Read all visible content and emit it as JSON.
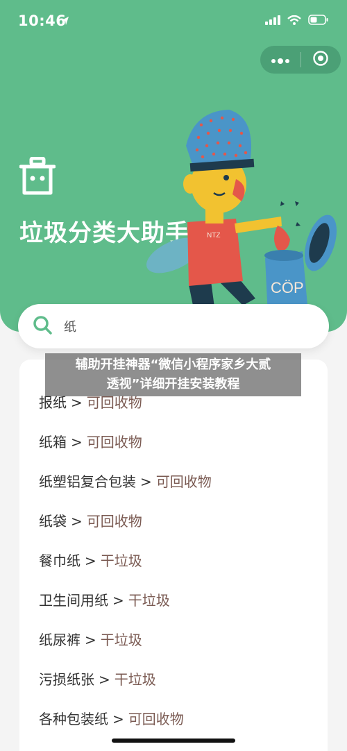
{
  "status_bar": {
    "time": "10:46"
  },
  "header": {
    "title": "垃圾分类大助手"
  },
  "search": {
    "value": "纸"
  },
  "results": [
    {
      "item": "报纸",
      "category": "可回收物"
    },
    {
      "item": "纸箱",
      "category": "可回收物"
    },
    {
      "item": "纸塑铝复合包装",
      "category": "可回收物"
    },
    {
      "item": "纸袋",
      "category": "可回收物"
    },
    {
      "item": "餐巾纸",
      "category": "干垃圾"
    },
    {
      "item": "卫生间用纸",
      "category": "干垃圾"
    },
    {
      "item": "纸尿裤",
      "category": "干垃圾"
    },
    {
      "item": "污损纸张",
      "category": "干垃圾"
    },
    {
      "item": "各种包装纸",
      "category": "可回收物"
    }
  ],
  "separator": ">",
  "watermark": {
    "line1": "辅助开挂神器“微信小程序家乡大贰",
    "line2": "透视”详细开挂安装教程"
  },
  "illustration": {
    "can_label": "CÖP"
  },
  "colors": {
    "brand_green": "#5fbc8b",
    "category_text": "#7a5a52"
  }
}
